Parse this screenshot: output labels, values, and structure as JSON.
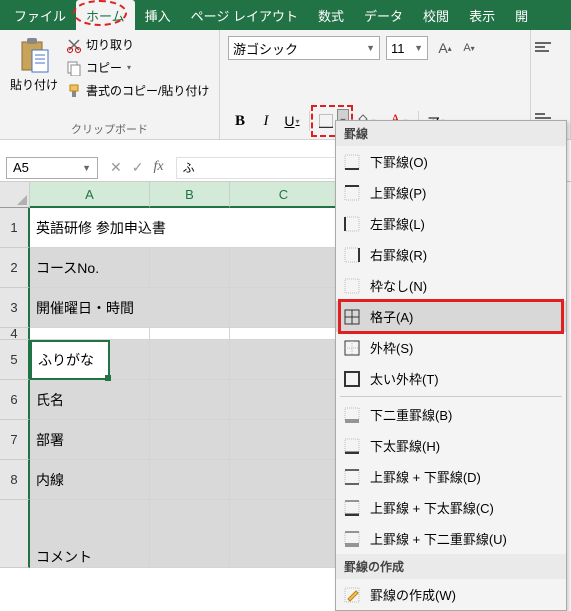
{
  "menu": {
    "items": [
      "ファイル",
      "ホーム",
      "挿入",
      "ページ レイアウト",
      "数式",
      "データ",
      "校閲",
      "表示",
      "開"
    ],
    "active_index": 1
  },
  "clipboard": {
    "paste": "貼り付け",
    "cut": "切り取り",
    "copy": "コピー",
    "format_painter": "書式のコピー/貼り付け",
    "group_label": "クリップボード"
  },
  "font": {
    "name": "游ゴシック",
    "size": "11",
    "bold": "B",
    "italic": "I",
    "underline": "U",
    "font_color_char": "A",
    "ruby_char": "ア"
  },
  "cell_ref": {
    "name_box": "A5",
    "formula": "ふ"
  },
  "columns": [
    "A",
    "B",
    "C"
  ],
  "rows": [
    "1",
    "2",
    "3",
    "4",
    "5",
    "6",
    "7",
    "8"
  ],
  "cells": {
    "a1": "英語研修 参加申込書",
    "a2": "コースNo.",
    "a3": "開催曜日・時間",
    "a5": "ふりがな",
    "a6": "氏名",
    "a7": "部署",
    "a8": "内線",
    "a9": "コメント"
  },
  "border_menu": {
    "header1": "罫線",
    "items1": [
      {
        "label": "下罫線(O)"
      },
      {
        "label": "上罫線(P)"
      },
      {
        "label": "左罫線(L)"
      },
      {
        "label": "右罫線(R)"
      },
      {
        "label": "枠なし(N)"
      },
      {
        "label": "格子(A)",
        "highlighted": true
      },
      {
        "label": "外枠(S)"
      },
      {
        "label": "太い外枠(T)"
      }
    ],
    "items2": [
      {
        "label": "下二重罫線(B)"
      },
      {
        "label": "下太罫線(H)"
      },
      {
        "label": "上罫線 + 下罫線(D)"
      },
      {
        "label": "上罫線 + 下太罫線(C)"
      },
      {
        "label": "上罫線 + 下二重罫線(U)"
      }
    ],
    "header2": "罫線の作成",
    "items3": [
      {
        "label": "罫線の作成(W)"
      }
    ]
  }
}
